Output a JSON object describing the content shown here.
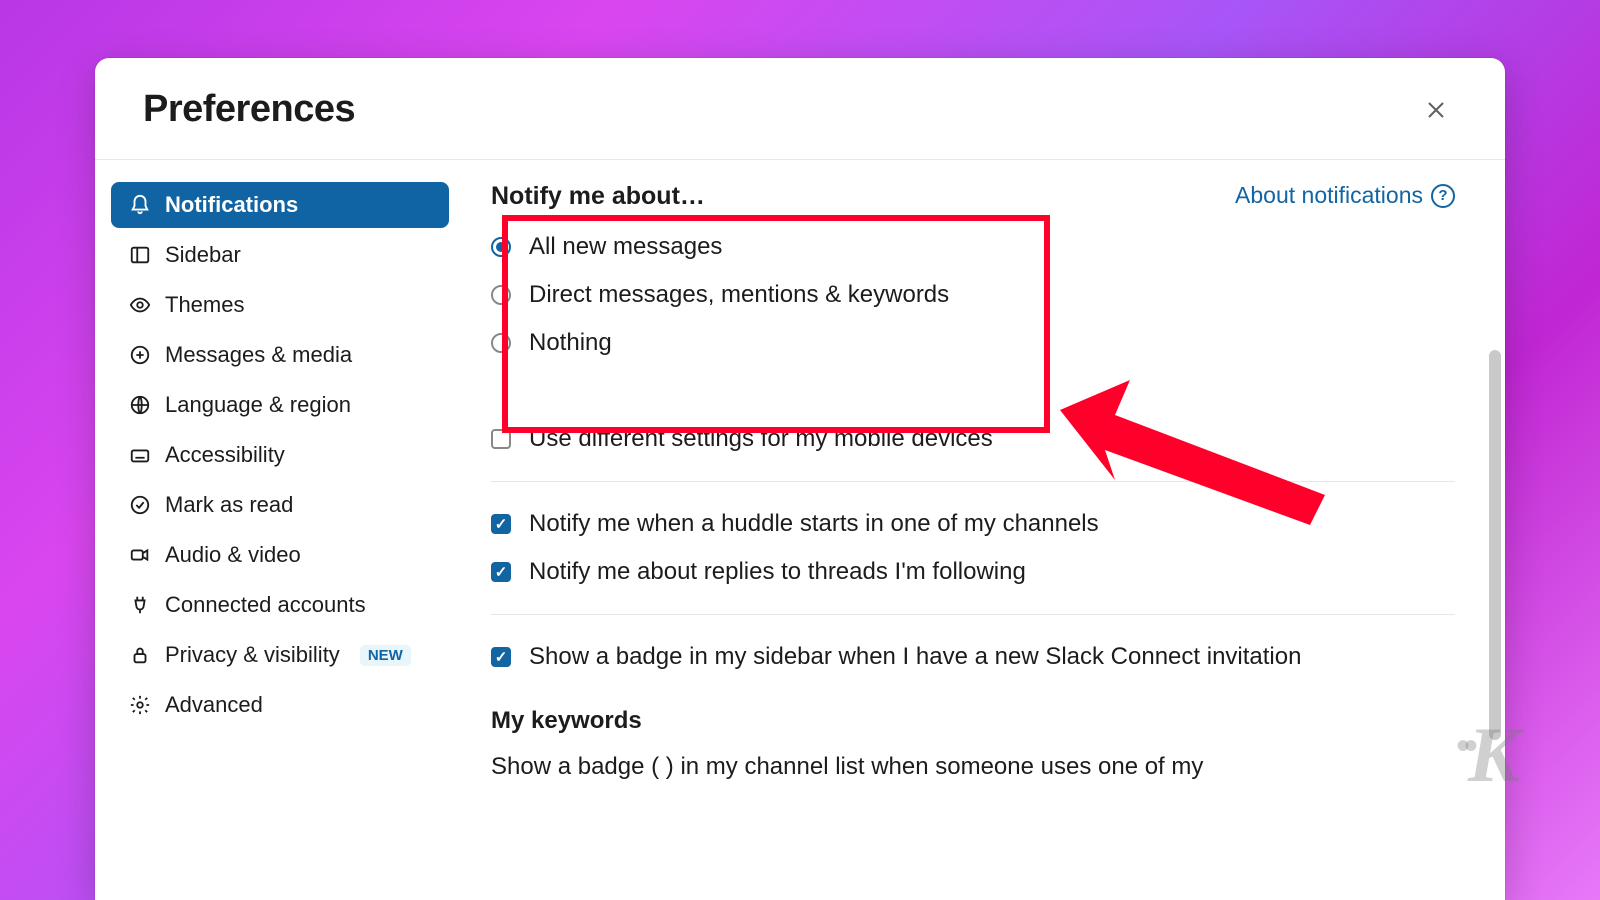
{
  "header": {
    "title": "Preferences"
  },
  "sidebar": {
    "items": [
      {
        "label": "Notifications",
        "active": true,
        "icon": "bell"
      },
      {
        "label": "Sidebar",
        "active": false,
        "icon": "layout-sidebar"
      },
      {
        "label": "Themes",
        "active": false,
        "icon": "eye"
      },
      {
        "label": "Messages & media",
        "active": false,
        "icon": "message"
      },
      {
        "label": "Language & region",
        "active": false,
        "icon": "globe"
      },
      {
        "label": "Accessibility",
        "active": false,
        "icon": "keyboard"
      },
      {
        "label": "Mark as read",
        "active": false,
        "icon": "check-circle"
      },
      {
        "label": "Audio & video",
        "active": false,
        "icon": "video"
      },
      {
        "label": "Connected accounts",
        "active": false,
        "icon": "plug"
      },
      {
        "label": "Privacy & visibility",
        "active": false,
        "icon": "lock",
        "badge": "NEW"
      },
      {
        "label": "Advanced",
        "active": false,
        "icon": "gear"
      }
    ]
  },
  "main": {
    "about_link": "About notifications",
    "notify_section_title": "Notify me about…",
    "notify_options": [
      {
        "label": "All new messages",
        "checked": true
      },
      {
        "label": "Direct messages, mentions & keywords",
        "checked": false
      },
      {
        "label": "Nothing",
        "checked": false
      }
    ],
    "mobile_checkbox": {
      "label": "Use different settings for my mobile devices",
      "checked": false
    },
    "huddle_checkbox": {
      "label": "Notify me when a huddle starts in one of my channels",
      "checked": true
    },
    "threads_checkbox": {
      "label": "Notify me about replies to threads I'm following",
      "checked": true
    },
    "connect_checkbox": {
      "label": "Show a badge in my sidebar when I have a new Slack Connect invitation",
      "checked": true
    },
    "keywords_title": "My keywords",
    "truncated_text": "Show a badge (  ) in my channel list when someone uses one of my"
  }
}
